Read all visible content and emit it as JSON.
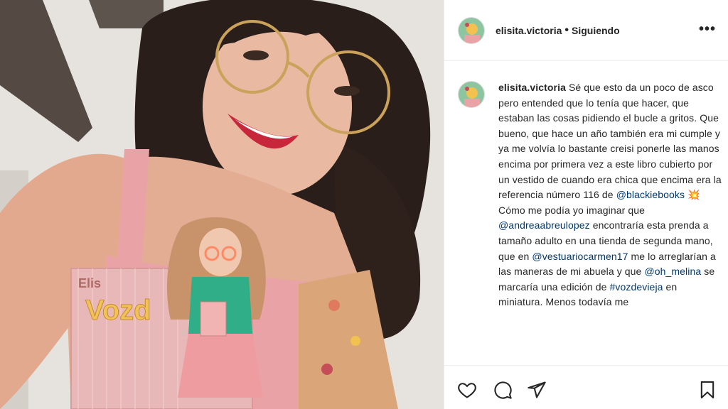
{
  "post": {
    "username": "elisita.victoria",
    "separator": "•",
    "follow_status": "Siguiendo",
    "more_label": "•••",
    "caption": {
      "username": "elisita.victoria",
      "seg1": " Sé que esto da un poco de asco pero entended que lo tenía que hacer, que estaban las cosas pidiendo el bucle a gritos. Que bueno, que hace un año también era mi cumple y ya me volvía lo bastante creisi ponerle las manos encima por primera vez a este libro cubierto por un vestido de cuando era chica que encima era la referencia número 116 de ",
      "mention1": "@blackiebooks",
      "emoji1": " 💥 ",
      "seg2": "Cómo me podía yo imaginar que ",
      "mention2": "@andreaabreulopez",
      "seg3": " encontraría esta prenda a tamaño adulto en una tienda de segunda mano, que en ",
      "mention3": "@vestuariocarmen17",
      "seg4": " me lo arreglarían a las maneras de mi abuela y que ",
      "mention4": "@oh_melina",
      "seg5": " se marcaría una edición de ",
      "hashtag1": "#vozdevieja",
      "seg6": " en miniatura. Menos todavía me"
    }
  },
  "photo": {
    "book_title_fragment": "Vozd",
    "book_author_fragment": "Elis"
  },
  "icons": {
    "like": "heart-icon",
    "comment": "comment-icon",
    "share": "share-icon",
    "save": "bookmark-icon"
  },
  "colors": {
    "text": "#262626",
    "mention": "#00376b",
    "border": "#efefef",
    "photo_dress": "#e9a3a6",
    "book_cover": "#e8b8b8",
    "book_title": "#f0c35a",
    "doll_shirt": "#2fae88"
  }
}
